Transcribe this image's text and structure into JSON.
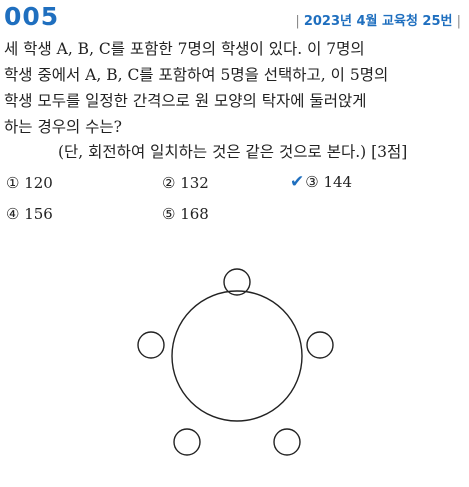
{
  "header": {
    "problem_number": "005",
    "source": "2023년 4월 교육청 25번"
  },
  "problem": {
    "lines": [
      "세 학생 A, B, C를 포함한 7명의 학생이 있다. 이 7명의",
      "학생 중에서 A, B, C를 포함하여 5명을 선택하고, 이 5명의",
      "학생 모두를 일정한 간격으로 원 모양의 탁자에 둘러앉게",
      "하는 경우의 수는?"
    ],
    "condition": "(단, 회전하여 일치하는 것은 같은 것으로 본다.) [3점]"
  },
  "choices": [
    {
      "label": "① 120",
      "selected": false
    },
    {
      "label": "② 132",
      "selected": false
    },
    {
      "label": "③ 144",
      "selected": true
    },
    {
      "label": "④ 156",
      "selected": false
    },
    {
      "label": "⑤ 168",
      "selected": false
    }
  ],
  "colors": {
    "accent": "#1f6fbf"
  },
  "icons": {
    "selected_mark": "check-icon"
  }
}
